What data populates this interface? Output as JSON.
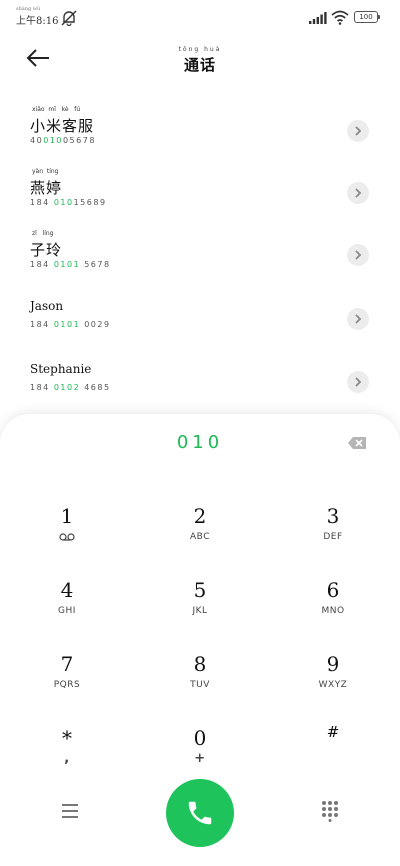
{
  "status_bar": {
    "time": "8:16",
    "time_prefix": "上午",
    "time_prefix_pinyin": "shàng wǔ",
    "battery": "100",
    "icons": [
      "mute-icon",
      "signal-icon",
      "wifi-icon",
      "battery-icon"
    ]
  },
  "header": {
    "title": "通话",
    "title_pinyin": "tōng huà",
    "back_icon": "arrow-left-icon"
  },
  "contacts": [
    {
      "pinyin": "xiǎo  mǐ   kè   fú",
      "name": "小米客服",
      "number_parts": [
        "40",
        "010",
        "05678"
      ]
    },
    {
      "pinyin": "yàn  tíng",
      "name": "燕婷",
      "number_parts": [
        "184 ",
        "010",
        "15689"
      ]
    },
    {
      "pinyin": "zǐ   líng",
      "name": "子玲",
      "number_parts": [
        "184 ",
        "0101",
        " 5678"
      ]
    },
    {
      "pinyin": "",
      "name": "Jason",
      "number_parts": [
        "184 ",
        "0101",
        " 0029"
      ]
    },
    {
      "pinyin": "",
      "name": "Stephanie",
      "number_parts": [
        "184 ",
        "0102",
        " 4685"
      ]
    }
  ],
  "dialpad": {
    "input_value": "010",
    "keys": [
      {
        "digit": "1",
        "letters": ""
      },
      {
        "digit": "2",
        "letters": "ABC"
      },
      {
        "digit": "3",
        "letters": "DEF"
      },
      {
        "digit": "4",
        "letters": "GHI"
      },
      {
        "digit": "5",
        "letters": "JKL"
      },
      {
        "digit": "6",
        "letters": "MNO"
      },
      {
        "digit": "7",
        "letters": "PQRS"
      },
      {
        "digit": "8",
        "letters": "TUV"
      },
      {
        "digit": "9",
        "letters": "WXYZ"
      },
      {
        "digit": "*",
        "letters": ","
      },
      {
        "digit": "0",
        "letters": "+"
      },
      {
        "digit": "#",
        "letters": ""
      }
    ]
  },
  "bottom_bar": {
    "icons": [
      "menu-icon",
      "phone-icon",
      "keypad-icon"
    ]
  },
  "colors": {
    "accent": "#1db954",
    "call_button": "#1ec45b",
    "detail_button_bg": "#ececec"
  }
}
